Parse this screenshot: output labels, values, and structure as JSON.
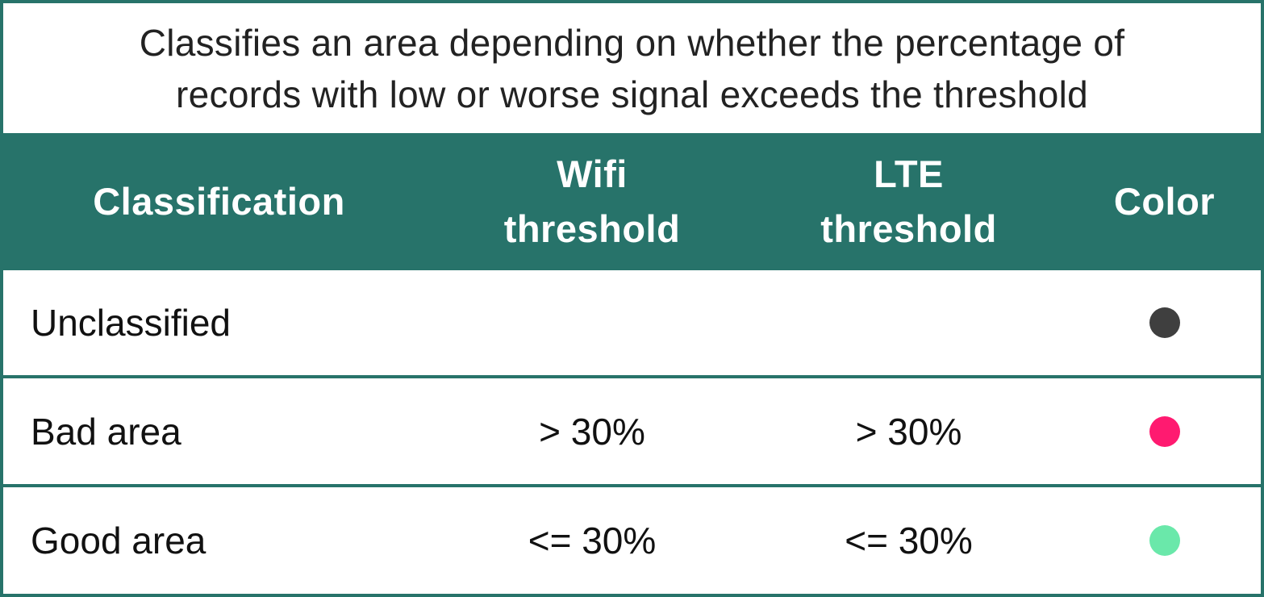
{
  "caption": {
    "line1": "Classifies an area depending on whether the percentage of",
    "line2": "records with low or worse signal exceeds the threshold"
  },
  "header": {
    "classification": "Classification",
    "wifi_line1": "Wifi",
    "wifi_line2": "threshold",
    "lte_line1": "LTE",
    "lte_line2": "threshold",
    "color": "Color"
  },
  "rows": [
    {
      "classification": "Unclassified",
      "wifi": "",
      "lte": "",
      "color": "#3F3F3F"
    },
    {
      "classification": "Bad area",
      "wifi": "> 30%",
      "lte": "> 30%",
      "color": "#FF1A70"
    },
    {
      "classification": "Good area",
      "wifi": "<= 30%",
      "lte": "<= 30%",
      "color": "#6AE8AA"
    }
  ],
  "theme": {
    "header_bg": "#27736A",
    "header_text": "#FFFFFF"
  }
}
